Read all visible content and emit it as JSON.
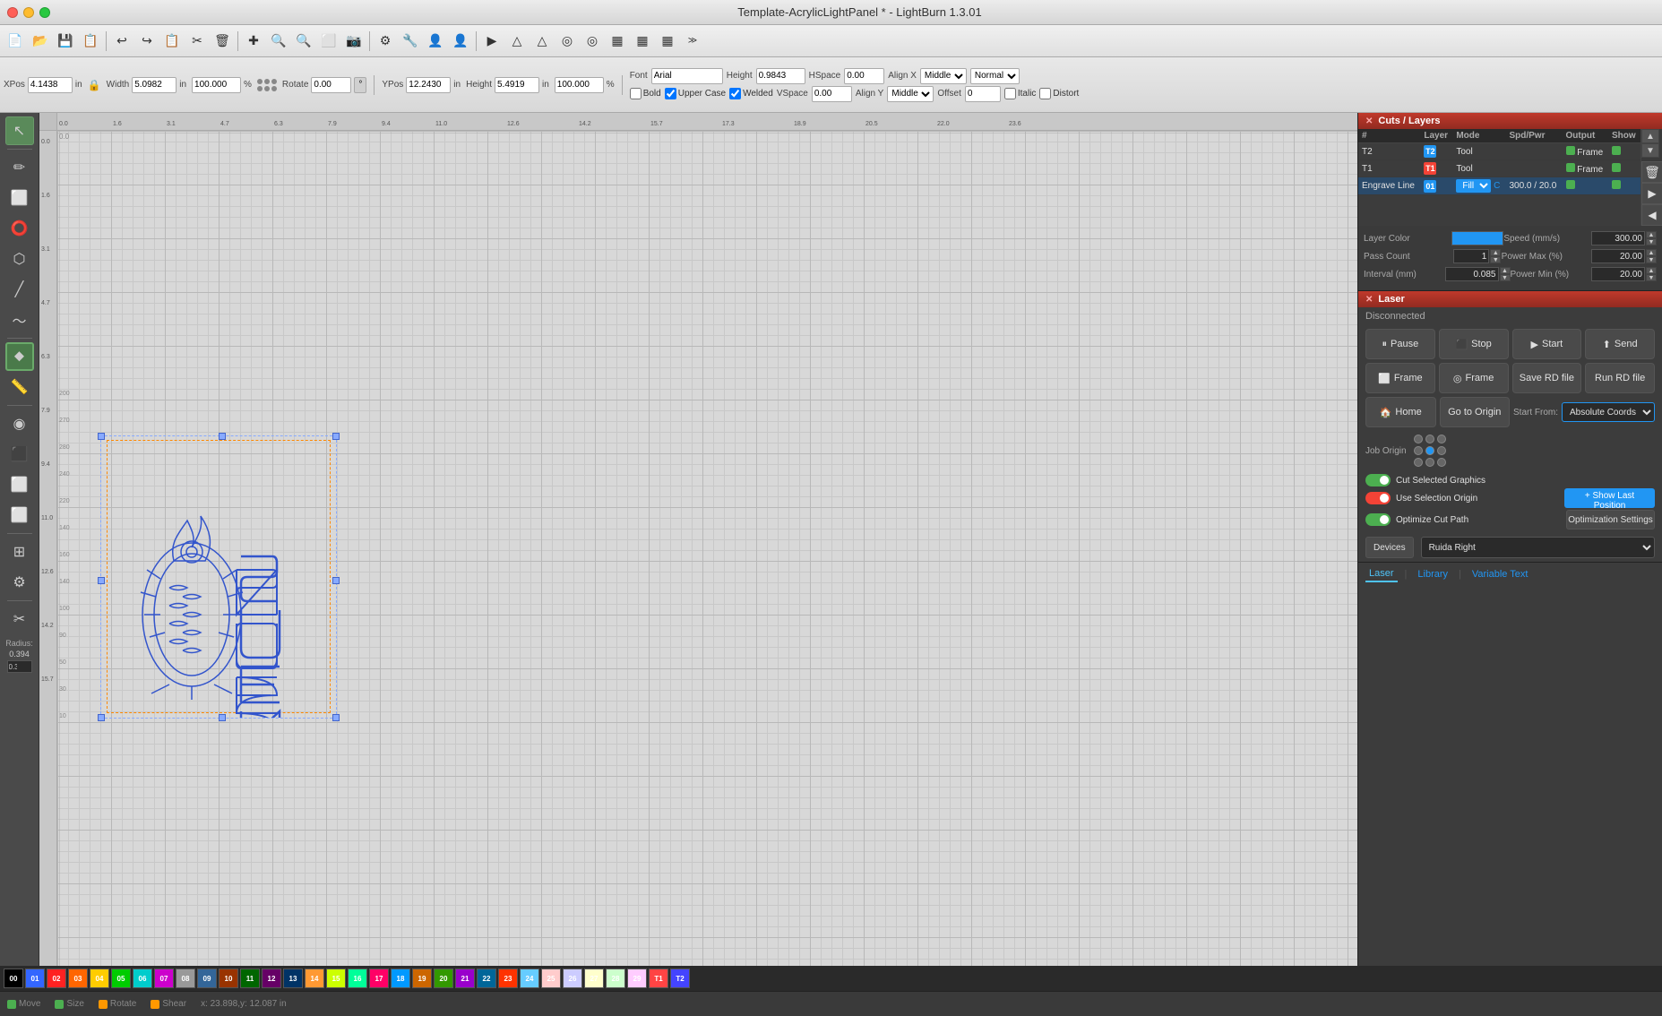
{
  "window": {
    "title": "Template-AcrylicLightPanel * - LightBurn 1.3.01"
  },
  "titlebar": {
    "close": "●",
    "minimize": "●",
    "maximize": "●"
  },
  "toolbar": {
    "buttons": [
      "📄",
      "💾",
      "🖨",
      "↩",
      "↪",
      "📋",
      "✂",
      "🗑",
      "✚",
      "🔍",
      "🔍",
      "🔍",
      "⬜",
      "📷",
      "⚙",
      "🔧",
      "👤",
      "👤",
      "▶",
      "△",
      "△",
      "◎",
      "◎",
      "▦",
      "▦",
      "▦",
      "▦",
      "❯❯"
    ]
  },
  "properties": {
    "xpos_label": "XPos",
    "xpos_value": "4.1438",
    "ypos_label": "YPos",
    "ypos_value": "12.2430",
    "unit_in": "in",
    "width_label": "Width",
    "width_value": "5.0982",
    "height_label": "Height",
    "height_value": "5.4919",
    "unit_in2": "in",
    "unit_in3": "in",
    "percent1": "100.000",
    "percent2": "100.000",
    "pct": "%",
    "pct2": "%",
    "rotate_label": "Rotate",
    "rotate_value": "0.00",
    "rotate_unit": "°",
    "font_label": "Font",
    "font_value": "Arial",
    "height_label2": "Height",
    "height_value2": "0.9843",
    "hspace_label": "HSpace",
    "hspace_value": "0.00",
    "align_x_label": "Align X",
    "align_x_value": "Middle",
    "normal_value": "Normal",
    "vspace_label": "VSpace",
    "vspace_value": "0.00",
    "align_y_label": "Align Y",
    "align_y_value": "Middle",
    "offset_label": "Offset",
    "offset_value": "0",
    "bold_label": "Bold",
    "italic_label": "Italic",
    "upper_case_label": "Upper Case",
    "distort_label": "Distort",
    "welded_label": "Welded"
  },
  "cuts_layers": {
    "title": "Cuts / Layers",
    "columns": [
      "#",
      "Layer",
      "Mode",
      "Spd/Pwr",
      "Output",
      "Show"
    ],
    "rows": [
      {
        "num": "T2",
        "layer": "T2",
        "layer_color": "blue",
        "mode": "Tool",
        "spd_pwr": "",
        "output": "Frame",
        "show": true
      },
      {
        "num": "T1",
        "layer": "T1",
        "layer_color": "red",
        "mode": "Tool",
        "spd_pwr": "",
        "output": "Frame",
        "show": true
      },
      {
        "num": "Engrave Line",
        "layer": "01",
        "layer_color": "blue",
        "mode": "Fill",
        "spd_pwr": "300.0 / 20.0",
        "output": true,
        "show": true
      }
    ],
    "layer_color_label": "Layer Color",
    "speed_label": "Speed (mm/s)",
    "speed_value": "300.00",
    "pass_count_label": "Pass Count",
    "pass_count_value": "1",
    "power_max_label": "Power Max (%)",
    "power_max_value": "20.00",
    "interval_label": "Interval (mm)",
    "interval_value": "0.085",
    "power_min_label": "Power Min (%)",
    "power_min_value": "20.00"
  },
  "laser": {
    "title": "Laser",
    "status": "Disconnected",
    "pause_btn": "Pause",
    "stop_btn": "Stop",
    "start_btn": "Start",
    "send_btn": "Send",
    "frame_btn1": "Frame",
    "frame_btn2": "Frame",
    "save_rd_btn": "Save RD file",
    "run_rd_btn": "Run RD file",
    "home_btn": "Home",
    "goto_origin_btn": "Go to Origin",
    "start_from_label": "Start From:",
    "start_from_value": "Absolute Coords",
    "job_origin_label": "Job Origin",
    "cut_selected_label": "Cut Selected Graphics",
    "use_selection_label": "Use Selection Origin",
    "optimize_cut_label": "Optimize Cut Path",
    "show_last_btn": "+ Show Last Position",
    "optimization_btn": "Optimization Settings",
    "devices_btn": "Devices",
    "device_value": "Ruida Right"
  },
  "bottom_tabs": {
    "laser_tab": "Laser",
    "library_tab": "Library",
    "variable_text_tab": "Variable Text"
  },
  "status_bar": {
    "move_label": "Move",
    "size_label": "Size",
    "rotate_label": "Rotate",
    "shear_label": "Shear",
    "coords": "x: 23.898,y: 12.087 in"
  },
  "color_swatches": [
    "00",
    "01",
    "02",
    "03",
    "04",
    "05",
    "06",
    "07",
    "08",
    "09",
    "10",
    "11",
    "12",
    "13",
    "14",
    "15",
    "16",
    "17",
    "18",
    "19",
    "20",
    "21",
    "22",
    "23",
    "24",
    "25",
    "26",
    "27",
    "28",
    "29",
    "T1",
    "T2"
  ],
  "swatch_colors": [
    "#000",
    "#3366ff",
    "#ff0000",
    "#ff6600",
    "#ffcc00",
    "#00cc00",
    "#00cccc",
    "#cc00cc",
    "#999999",
    "#336699",
    "#993300",
    "#006600",
    "#660066",
    "#003366",
    "#ff9933",
    "#ccff00",
    "#00ff99",
    "#ff0066",
    "#0099ff",
    "#cc6600",
    "#339900",
    "#9900cc",
    "#006699",
    "#ff3300",
    "#66ccff",
    "#ffcccc",
    "#ccccff",
    "#ffffcc",
    "#ccffcc",
    "#ffccff",
    "#ff4444",
    "#4444ff"
  ]
}
